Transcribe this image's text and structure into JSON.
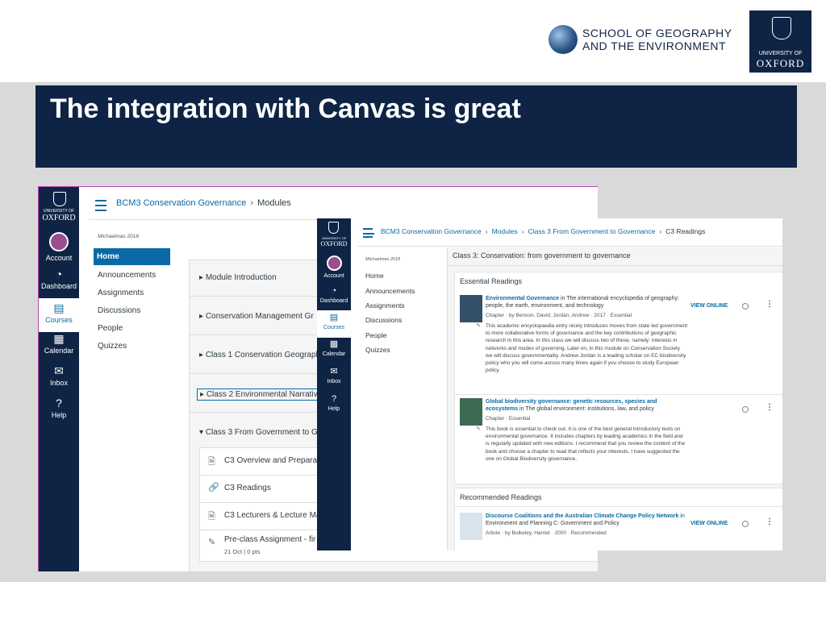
{
  "slide": {
    "title": "The integration with Canvas is great",
    "school_name_line1": "SCHOOL OF GEOGRAPHY",
    "school_name_line2": "AND THE ENVIRONMENT",
    "oxford_badge_small": "UNIVERSITY OF",
    "oxford_badge_large": "OXFORD",
    "colors": {
      "navy": "#0f2445",
      "grey": "#d9d9d9",
      "canvas_blue": "#0b6aa5"
    }
  },
  "shot1": {
    "logo_small": "UNIVERSITY OF",
    "logo_large": "OXFORD",
    "global_nav": [
      {
        "label": "Account",
        "icon": "avatar-icon"
      },
      {
        "label": "Dashboard",
        "icon": "dashboard-icon",
        "glyph": "◔"
      },
      {
        "label": "Courses",
        "icon": "courses-icon",
        "glyph": "▤",
        "active": true
      },
      {
        "label": "Calendar",
        "icon": "calendar-icon",
        "glyph": "▦"
      },
      {
        "label": "Inbox",
        "icon": "inbox-icon",
        "glyph": "✉"
      },
      {
        "label": "Help",
        "icon": "help-icon",
        "glyph": "?"
      }
    ],
    "breadcrumb": [
      "BCM3 Conservation Governance",
      "Modules"
    ],
    "term": "Michaelmas 2018",
    "course_nav": [
      "Home",
      "Announcements",
      "Assignments",
      "Discussions",
      "People",
      "Quizzes"
    ],
    "modules": [
      "Module Introduction",
      "Conservation Management Gr",
      "Class 1 Conservation Geograph",
      "Class 2 Environmental Narrativ",
      "Class 3 From Government to Go"
    ],
    "module_items": [
      {
        "title": "C3 Overview and Preparat",
        "icon": "page-icon",
        "glyph": "🗎"
      },
      {
        "title": "C3 Readings",
        "icon": "link-icon",
        "glyph": "🔗"
      },
      {
        "title": "C3 Lecturers & Lecture Ma",
        "icon": "page-icon",
        "glyph": "🗎"
      },
      {
        "title": "Pre-class Assignment - fir",
        "icon": "assignment-icon",
        "glyph": "✎",
        "sub": "21 Oct | 0 pts"
      }
    ]
  },
  "shot2": {
    "logo_small": "UNIVERSITY OF",
    "logo_large": "OXFORD",
    "global_nav": [
      {
        "label": "Account",
        "icon": "avatar-icon"
      },
      {
        "label": "Dashboard",
        "icon": "dashboard-icon",
        "glyph": "◔"
      },
      {
        "label": "Courses",
        "icon": "courses-icon",
        "glyph": "▤",
        "active": true
      },
      {
        "label": "Calendar",
        "icon": "calendar-icon",
        "glyph": "▦"
      },
      {
        "label": "Inbox",
        "icon": "inbox-icon",
        "glyph": "✉"
      },
      {
        "label": "Help",
        "icon": "help-icon",
        "glyph": "?"
      }
    ],
    "breadcrumb": [
      "BCM3 Conservation Governance",
      "Modules",
      "Class 3 From Government to Governance",
      "C3 Readings"
    ],
    "term": "Michaelmas 2018",
    "course_nav": [
      "Home",
      "Announcements",
      "Assignments",
      "Discussions",
      "People",
      "Quizzes"
    ],
    "page_heading": "Class 3: Conservation: from government to governance",
    "essential_heading": "Essential Readings",
    "recommended_heading": "Recommended Readings",
    "view_online": "VIEW ONLINE",
    "readings": [
      {
        "title_link": "Environmental Governance",
        "title_rest": " in The international encyclopedia of geography: people, the earth, environment, and technology",
        "meta": "Chapter · by Benson, David; Jordan, Andrew · 2017 · Essential",
        "note": "This academic encyclopaedia entry nicely introduces moves from state led government to more collaborative forms of governance and the key contributions of geographic research in this area. In this class we will discuss two of these, namely: interests in networks and modes of governing. Later on, in this module on Conservation Society we will discuss governmentality. Andrew Jordan is a leading scholar on EC biodiversity policy who you will come across many times again if you choose to study European policy."
      },
      {
        "title_link": "Global biodiversity governance: genetic resources, species and ecosystems",
        "title_rest": " in The global environment: institutions, law, and policy",
        "meta": "Chapter · Essential",
        "note": "This book is essential to check out. It is one of the best general introductory texts on environmental governance. It includes chapters by leading academics in the field and is regularly updated with new editions. I recommend that you review the content of the book and choose a chapter to read that reflects your interests. I have suggested the one on Global Biodiversity governance."
      },
      {
        "title_link": "Discourse Coalitions and the Australian Climate Change Policy Network",
        "title_rest": " in Environment and Planning C: Government and Policy",
        "meta": "Article · by Bulkeley, Harriet · 2000 · Recommended",
        "note": ""
      }
    ]
  }
}
